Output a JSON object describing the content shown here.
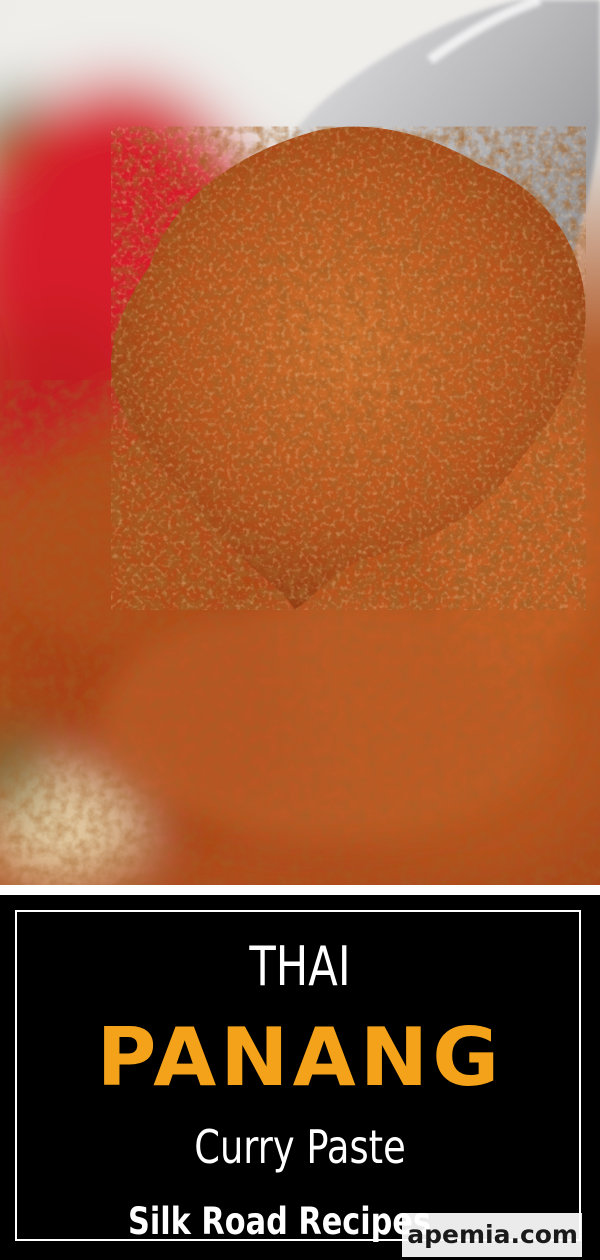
{
  "photo": {
    "subject": "curry paste on a spoon"
  },
  "banner": {
    "line1": "THAI",
    "line2": "PANANG",
    "line3": "Curry Paste",
    "brand": "Silk Road Recipes"
  },
  "watermark": {
    "text": "apemia.com"
  },
  "colors": {
    "banner_background": "#000000",
    "accent": "#f4a21a",
    "text": "#ffffff",
    "paste": "#b9501c",
    "chili": "#d8272b"
  }
}
